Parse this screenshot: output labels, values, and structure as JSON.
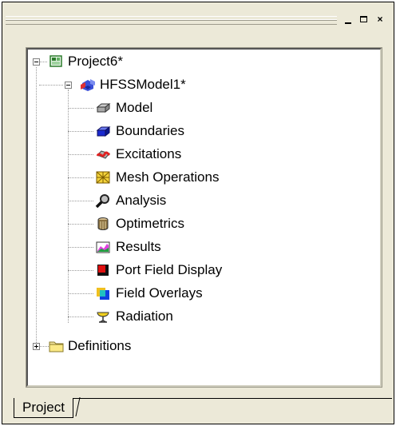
{
  "window": {
    "controls": {
      "minimize": "minimize-icon",
      "maximize": "maximize-icon",
      "close": "×"
    }
  },
  "tree": {
    "root": {
      "label": "Project6*",
      "icon": "project-icon",
      "expander": "−"
    },
    "model": {
      "label": "HFSSModel1*",
      "icon": "hfss-model-icon",
      "expander": "−"
    },
    "children": [
      {
        "label": "Model",
        "icon": "model-icon"
      },
      {
        "label": "Boundaries",
        "icon": "boundaries-icon"
      },
      {
        "label": "Excitations",
        "icon": "excitations-icon"
      },
      {
        "label": "Mesh Operations",
        "icon": "mesh-operations-icon"
      },
      {
        "label": "Analysis",
        "icon": "analysis-icon"
      },
      {
        "label": "Optimetrics",
        "icon": "optimetrics-icon"
      },
      {
        "label": "Results",
        "icon": "results-icon"
      },
      {
        "label": "Port Field Display",
        "icon": "port-field-display-icon"
      },
      {
        "label": "Field Overlays",
        "icon": "field-overlays-icon"
      },
      {
        "label": "Radiation",
        "icon": "radiation-icon"
      }
    ],
    "definitions": {
      "label": "Definitions",
      "icon": "folder-icon",
      "expander": "+"
    }
  },
  "tabs": [
    {
      "label": "Project"
    }
  ]
}
